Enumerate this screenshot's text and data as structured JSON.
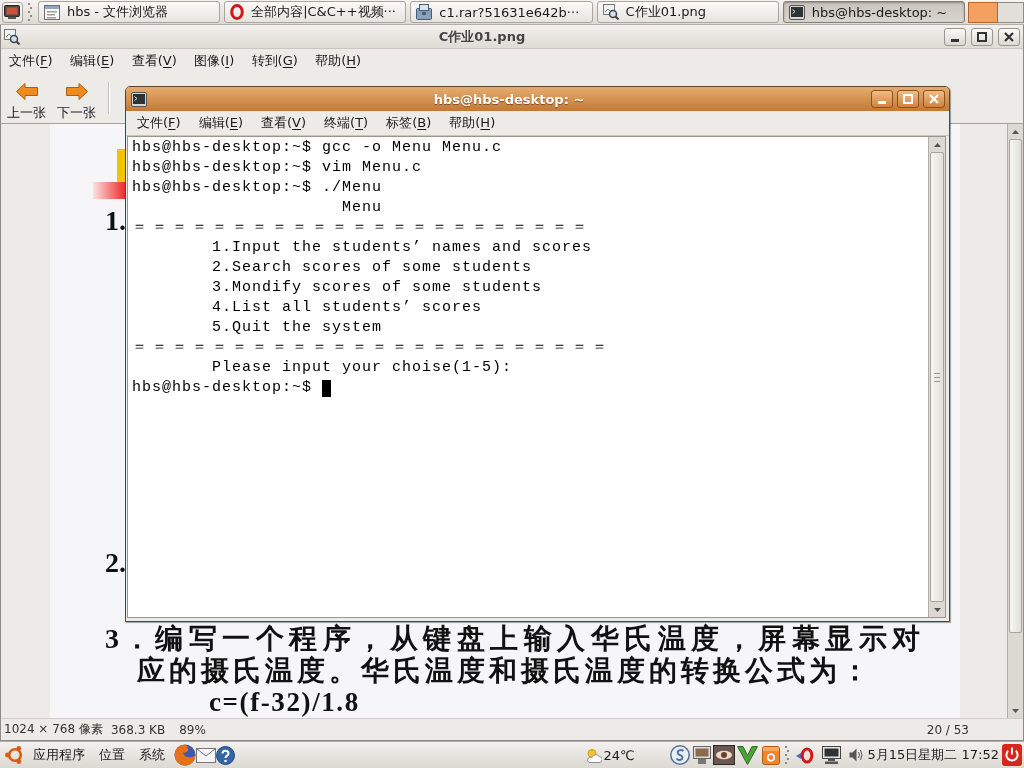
{
  "top_panel": {
    "tasks": [
      {
        "kind": "files",
        "label": "hbs - 文件浏览器",
        "selected": false
      },
      {
        "kind": "browser",
        "label": "全部内容|C&C++视频···",
        "selected": false
      },
      {
        "kind": "archive",
        "label": "c1.rar?51631e642b···",
        "selected": false
      },
      {
        "kind": "viewer",
        "label": "C作业01.png",
        "selected": false
      },
      {
        "kind": "terminal",
        "label": "hbs@hbs-desktop: ~",
        "selected": true
      }
    ],
    "workspaces": [
      {
        "selected": true
      },
      {
        "selected": false
      }
    ]
  },
  "viewer": {
    "title": "C作业01.png",
    "menu": [
      "文件(F)",
      "编辑(E)",
      "查看(V)",
      "图像(I)",
      "转到(G)",
      "帮助(H)"
    ],
    "toolbar": [
      {
        "kind": "previous",
        "label": "上一张"
      },
      {
        "kind": "next",
        "label": "下一张"
      }
    ],
    "document": {
      "items": [
        {
          "number": "1."
        },
        {
          "number": "2."
        },
        {
          "number": "3．",
          "lines": [
            "编写一个程序，从键盘上输入华氏温度，屏幕显示对",
            "应的摄氏温度。华氏温度和摄氏温度的转换公式为："
          ],
          "formula": "c=(f-32)/1.8"
        }
      ]
    },
    "status_bar": {
      "dimensions": "1024 × 768 像素",
      "file_size": "368.3 KB",
      "zoom": "89%",
      "position": "20 / 53"
    }
  },
  "terminal": {
    "title": "hbs@hbs-desktop: ~",
    "menu": [
      "文件(F)",
      "编辑(E)",
      "查看(V)",
      "终端(T)",
      "标签(B)",
      "帮助(H)"
    ],
    "lines": [
      {
        "kind": "shell",
        "text": "hbs@hbs-desktop:~$ gcc -o Menu Menu.c"
      },
      {
        "kind": "shell",
        "text": "hbs@hbs-desktop:~$ vim Menu.c"
      },
      {
        "kind": "shell",
        "text": "hbs@hbs-desktop:~$ ./Menu"
      },
      {
        "kind": "heading",
        "text": "Menu"
      },
      {
        "kind": "rule",
        "text": "＝＝＝＝＝＝＝＝＝＝＝＝＝＝＝＝＝＝＝＝＝＝＝"
      },
      {
        "kind": "option",
        "text": "1.Input the students’ names and scores"
      },
      {
        "kind": "option",
        "text": "2.Search scores of some students"
      },
      {
        "kind": "option",
        "text": "3.Mondify scores of some students"
      },
      {
        "kind": "option",
        "text": "4.List all students’ scores"
      },
      {
        "kind": "option",
        "text": "5.Quit the system"
      },
      {
        "kind": "rule",
        "text": "＝＝＝＝＝＝＝＝＝＝＝＝＝＝＝＝＝＝＝＝＝＝＝＝"
      },
      {
        "kind": "option",
        "text": "Please input your choise(1-5):"
      },
      {
        "kind": "prompt",
        "text": "hbs@hbs-desktop:~$"
      }
    ]
  },
  "bottom_panel": {
    "menus": [
      "应用程序",
      "位置",
      "系统"
    ],
    "weather": "24℃",
    "clock": "5月15日星期二 17:52"
  }
}
